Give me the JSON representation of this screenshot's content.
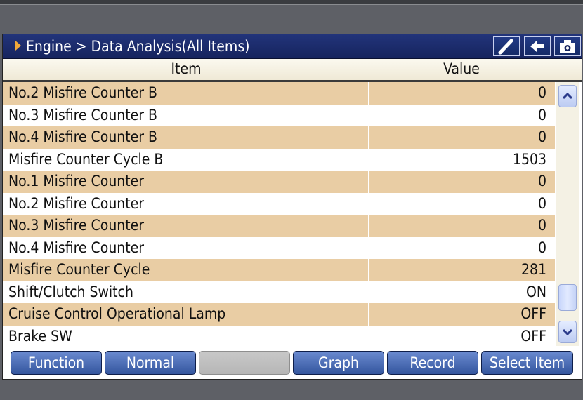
{
  "title": {
    "breadcrumb": "Engine > Data Analysis(All Items)"
  },
  "toolbar": {
    "icons": [
      "brush-icon",
      "back-arrow-icon",
      "camera-icon"
    ]
  },
  "table": {
    "headers": {
      "item": "Item",
      "value": "Value"
    },
    "rows": [
      {
        "item": "No.2 Misfire Counter B",
        "value": "0"
      },
      {
        "item": "No.3 Misfire Counter B",
        "value": "0"
      },
      {
        "item": "No.4 Misfire Counter B",
        "value": "0"
      },
      {
        "item": "Misfire Counter Cycle B",
        "value": "1503"
      },
      {
        "item": "No.1 Misfire Counter",
        "value": "0"
      },
      {
        "item": "No.2 Misfire Counter",
        "value": "0"
      },
      {
        "item": "No.3 Misfire Counter",
        "value": "0"
      },
      {
        "item": "No.4 Misfire Counter",
        "value": "0"
      },
      {
        "item": "Misfire Counter Cycle",
        "value": "281"
      },
      {
        "item": "Shift/Clutch Switch",
        "value": "ON"
      },
      {
        "item": "Cruise Control Operational Lamp",
        "value": "OFF"
      },
      {
        "item": "Brake SW",
        "value": "OFF"
      }
    ]
  },
  "buttons": {
    "function": "Function",
    "normal": "Normal",
    "blank": "",
    "graph": "Graph",
    "record": "Record",
    "select_item": "Select Item"
  },
  "colors": {
    "titlebar": "#1b2c6c",
    "row_shade": "#e9cda4",
    "button": "#4a6cb8",
    "title_arrow": "#f0a83a"
  }
}
